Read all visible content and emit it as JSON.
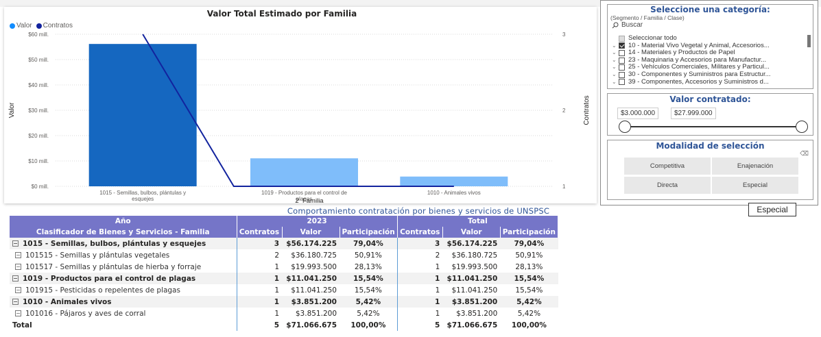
{
  "chart": {
    "title": "Valor Total Estimado por Familia",
    "legend": [
      {
        "label": "Valor",
        "color": "#118dff"
      },
      {
        "label": "Contratos",
        "color": "#12239e"
      }
    ],
    "y_left_ticks": [
      "$0 mill.",
      "$10 mill.",
      "$20 mill.",
      "$30 mill.",
      "$40 mill.",
      "$50 mill.",
      "$60 mill."
    ],
    "y_right_ticks": [
      "1",
      "2",
      "3"
    ],
    "y_left_label": "Valor",
    "y_right_label": "Contratos",
    "x_label": "2_Familia",
    "categories": [
      [
        "1015 - Semillas, bulbos, plántulas y",
        "esquejes"
      ],
      [
        "1019 - Productos para el control de",
        "plagas"
      ],
      [
        "1010 - Animales vivos"
      ]
    ]
  },
  "chart_data": {
    "type": "bar",
    "title": "Valor Total Estimado por Familia",
    "xlabel": "2_Familia",
    "ylabel": "Valor",
    "y2label": "Contratos",
    "categories": [
      "1015 - Semillas, bulbos, plántulas y esquejes",
      "1019 - Productos para el control de plagas",
      "1010 - Animales vivos"
    ],
    "series": [
      {
        "name": "Valor",
        "type": "bar",
        "values": [
          56.17,
          11.04,
          3.85
        ],
        "colors": [
          "#1567c0",
          "#7fbdfa",
          "#7fbdfa"
        ],
        "axis": "left"
      },
      {
        "name": "Contratos",
        "type": "line",
        "values": [
          3,
          1,
          1
        ],
        "color": "#12239e",
        "axis": "right"
      }
    ],
    "ylim": [
      0,
      60
    ],
    "y2lim": [
      1,
      3
    ],
    "grid": true,
    "legend_position": "top-left"
  },
  "table": {
    "title": "Comportamiento contratación por bienes y servicios de UNSPSC",
    "header_row1": {
      "col0": "Año",
      "group1": "2023",
      "group2": "Total"
    },
    "header_row2": [
      "Clasificador de Bienes y Servicios - Familia",
      "Contratos",
      "Valor",
      "Participación",
      "Contratos",
      "Valor",
      "Participación"
    ],
    "rows": [
      {
        "level": 1,
        "label": "1015 - Semillas, bulbos, plántulas y esquejes",
        "c1": "3",
        "v1": "$56.174.225",
        "p1": "79,04%",
        "c2": "3",
        "v2": "$56.174.225",
        "p2": "79,04%"
      },
      {
        "level": 2,
        "label": "101515 - Semillas y plántulas vegetales",
        "c1": "2",
        "v1": "$36.180.725",
        "p1": "50,91%",
        "c2": "2",
        "v2": "$36.180.725",
        "p2": "50,91%"
      },
      {
        "level": 2,
        "label": "101517 - Semillas y plántulas de hierba y forraje",
        "c1": "1",
        "v1": "$19.993.500",
        "p1": "28,13%",
        "c2": "1",
        "v2": "$19.993.500",
        "p2": "28,13%"
      },
      {
        "level": 1,
        "label": "1019 - Productos para el control de plagas",
        "c1": "1",
        "v1": "$11.041.250",
        "p1": "15,54%",
        "c2": "1",
        "v2": "$11.041.250",
        "p2": "15,54%"
      },
      {
        "level": 2,
        "label": "101915 - Pesticidas o repelentes de plagas",
        "c1": "1",
        "v1": "$11.041.250",
        "p1": "15,54%",
        "c2": "1",
        "v2": "$11.041.250",
        "p2": "15,54%"
      },
      {
        "level": 1,
        "label": "1010 - Animales vivos",
        "c1": "1",
        "v1": "$3.851.200",
        "p1": "5,42%",
        "c2": "1",
        "v2": "$3.851.200",
        "p2": "5,42%"
      },
      {
        "level": 2,
        "label": "101016 - Pájaros y aves de corral",
        "c1": "1",
        "v1": "$3.851.200",
        "p1": "5,42%",
        "c2": "1",
        "v2": "$3.851.200",
        "p2": "5,42%"
      }
    ],
    "total": {
      "label": "Total",
      "c1": "5",
      "v1": "$71.066.675",
      "p1": "100,00%",
      "c2": "5",
      "v2": "$71.066.675",
      "p2": "100,00%"
    }
  },
  "category_slicer": {
    "title": "Seleccione una categoría:",
    "subtitle": "(Segmento / Familia / Clase)",
    "search_placeholder": "Buscar",
    "items": [
      {
        "label": "Seleccionar todo",
        "state": "partial",
        "chevron": false
      },
      {
        "label": "10 - Material Vivo Vegetal y Animal, Accesorios...",
        "state": "checked",
        "chevron": true
      },
      {
        "label": "14 - Materiales y Productos de Papel",
        "state": "unchecked",
        "chevron": true
      },
      {
        "label": "23 - Maquinaria y Accesorios para Manufactur...",
        "state": "unchecked",
        "chevron": true
      },
      {
        "label": "25 - Vehículos Comerciales, Militares y Particul...",
        "state": "unchecked",
        "chevron": true
      },
      {
        "label": "30 - Componentes y Suministros para Estructur...",
        "state": "unchecked",
        "chevron": true
      },
      {
        "label": "39 - Componentes, Accesorios y Suministros d...",
        "state": "unchecked",
        "chevron": true
      }
    ]
  },
  "value_slicer": {
    "title": "Valor contratado:",
    "min": "$3.000.000",
    "max": "$27.999.000"
  },
  "modality_slicer": {
    "title": "Modalidad de selección",
    "options": [
      "Competitiva",
      "Enajenación",
      "Directa",
      "Especial"
    ]
  },
  "tooltip": {
    "text": "Especial"
  }
}
